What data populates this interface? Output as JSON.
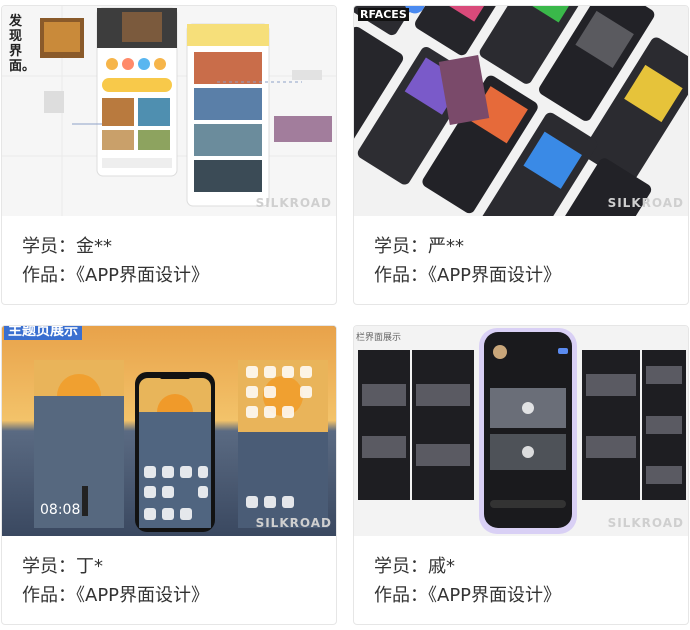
{
  "works": [
    {
      "student_label": "学员：",
      "student_name": "金**",
      "work_label": "作品：",
      "work_title": "《APP界面设计》",
      "thumb_title": "发现界面。",
      "watermark": "SILKROAD"
    },
    {
      "student_label": "学员：",
      "student_name": "严**",
      "work_label": "作品：",
      "work_title": "《APP界面设计》",
      "thumb_title": "RFACES",
      "watermark": "SILKROAD"
    },
    {
      "student_label": "学员：",
      "student_name": "丁*",
      "work_label": "作品：",
      "work_title": "《APP界面设计》",
      "thumb_title": "主题页展示",
      "clock": "08:08",
      "watermark": "SILKROAD"
    },
    {
      "student_label": "学员：",
      "student_name": "戚*",
      "work_label": "作品：",
      "work_title": "《APP界面设计》",
      "thumb_title": "栏界面展示",
      "watermark": "SILKROAD"
    }
  ]
}
